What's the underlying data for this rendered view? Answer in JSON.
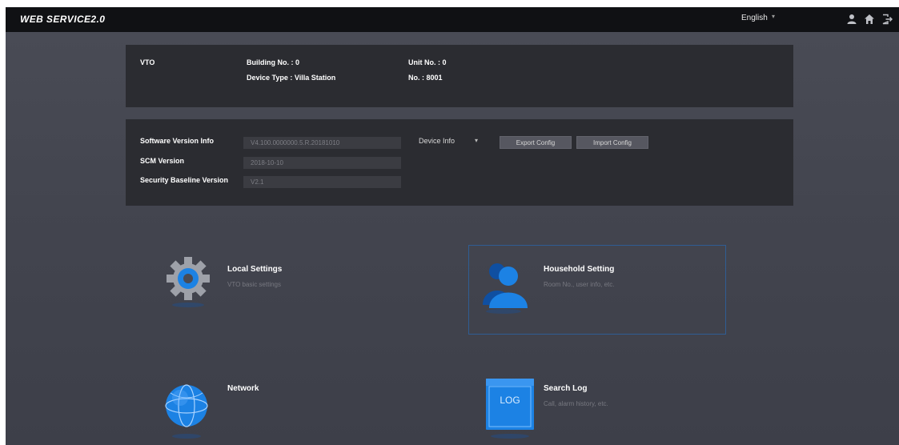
{
  "header": {
    "brand": "WEB SERVICE2.0",
    "language": "English",
    "icons": [
      "user-icon",
      "home-icon",
      "logout-icon"
    ]
  },
  "device": {
    "type_label": "VTO",
    "building": "Building No. : 0",
    "device_type": "Device Type : Villa Station",
    "unit": "Unit No. : 0",
    "number": "No. : 8001"
  },
  "versions": {
    "software_label": "Software Version Info",
    "software_value": "V4.100.0000000.5.R.20181010",
    "scm_label": "SCM Version",
    "scm_value": "2018-10-10",
    "baseline_label": "Security Baseline Version",
    "baseline_value": "V2.1",
    "device_info_select": "Device Info",
    "export_label": "Export Config",
    "import_label": "Import Config"
  },
  "tiles": [
    {
      "title": "Local Settings",
      "desc": "VTO basic settings",
      "icon": "gear-icon"
    },
    {
      "title": "Household Setting",
      "desc": "Room No., user info, etc.",
      "icon": "person-icon"
    },
    {
      "title": "Network",
      "desc": "",
      "icon": "globe-icon"
    },
    {
      "title": "Search Log",
      "desc": "Call, alarm history, etc.",
      "icon": "log-icon",
      "icon_text": "LOG"
    }
  ],
  "colors": {
    "topbar": "#101114",
    "background": "#45474f",
    "panel": "#2b2c31",
    "accent_blue": "#1c82e4",
    "selection_border": "#2f5d93"
  }
}
